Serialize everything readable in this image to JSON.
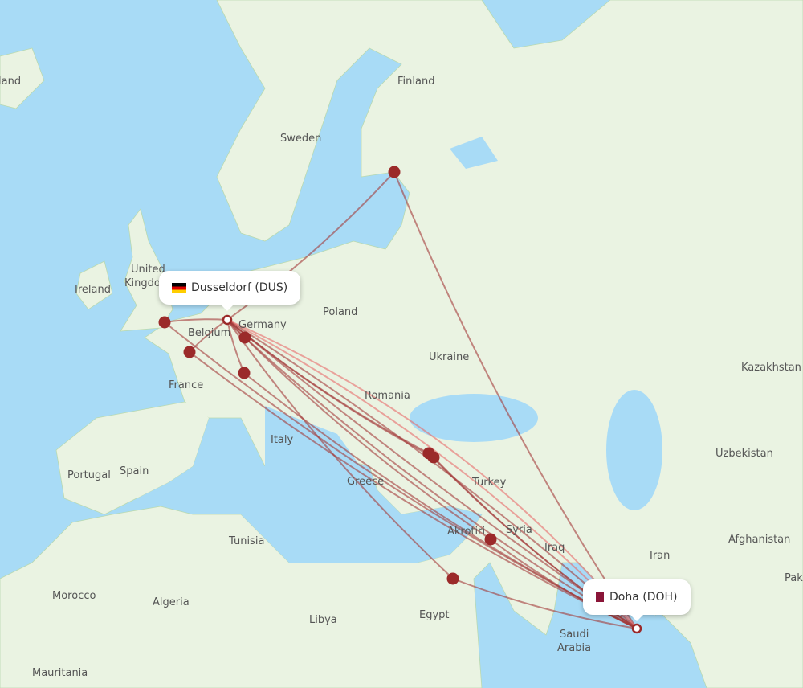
{
  "origin": {
    "name": "Dusseldorf (DUS)",
    "flag": "germany-flag-icon"
  },
  "destination": {
    "name": "Doha (DOH)",
    "flag": "qatar-flag-icon"
  },
  "colors": {
    "water": "#a8dbf6",
    "land": "#eaf3e2",
    "route": "#a33a3a",
    "route_highlight": "#e86a6a",
    "airport": "#9b2a2a"
  },
  "country_labels": [
    {
      "text": "Finland"
    },
    {
      "text": "Sweden"
    },
    {
      "text": "United"
    },
    {
      "text": "Kingdom"
    },
    {
      "text": "Ireland"
    },
    {
      "text": "Poland"
    },
    {
      "text": "Germany"
    },
    {
      "text": "Belgium"
    },
    {
      "text": "France"
    },
    {
      "text": "Ukraine"
    },
    {
      "text": "Romania"
    },
    {
      "text": "Italy"
    },
    {
      "text": "Portugal"
    },
    {
      "text": "Spain"
    },
    {
      "text": "Greece"
    },
    {
      "text": "Turkey"
    },
    {
      "text": "Akrotiri"
    },
    {
      "text": "Syria"
    },
    {
      "text": "Iraq"
    },
    {
      "text": "Iran"
    },
    {
      "text": "Kazakhstan"
    },
    {
      "text": "Uzbekistan"
    },
    {
      "text": "Afghanistan"
    },
    {
      "text": "Pak"
    },
    {
      "text": "Tunisia"
    },
    {
      "text": "Morocco"
    },
    {
      "text": "Algeria"
    },
    {
      "text": "Libya"
    },
    {
      "text": "Egypt"
    },
    {
      "text": "Saudi"
    },
    {
      "text": "Arabia"
    },
    {
      "text": "Mauritania"
    },
    {
      "text": "land"
    }
  ]
}
